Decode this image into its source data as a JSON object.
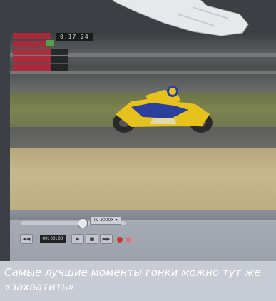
{
  "overlay": {
    "timer": "0:17.24"
  },
  "player": {
    "file_select": "Tv-3000X  ▾",
    "time": "00:00:00",
    "seek_fraction": 0.58,
    "controls": [
      "◀◀",
      "▶",
      "■",
      "▶▶"
    ]
  },
  "caption": {
    "text": "Самые лучшие моменты гонки можно тут же «захватить»"
  },
  "colors": {
    "caption_bg": "#c7cbd3",
    "bike_yellow": "#e8c21c",
    "bike_blue": "#2b3f9c"
  }
}
